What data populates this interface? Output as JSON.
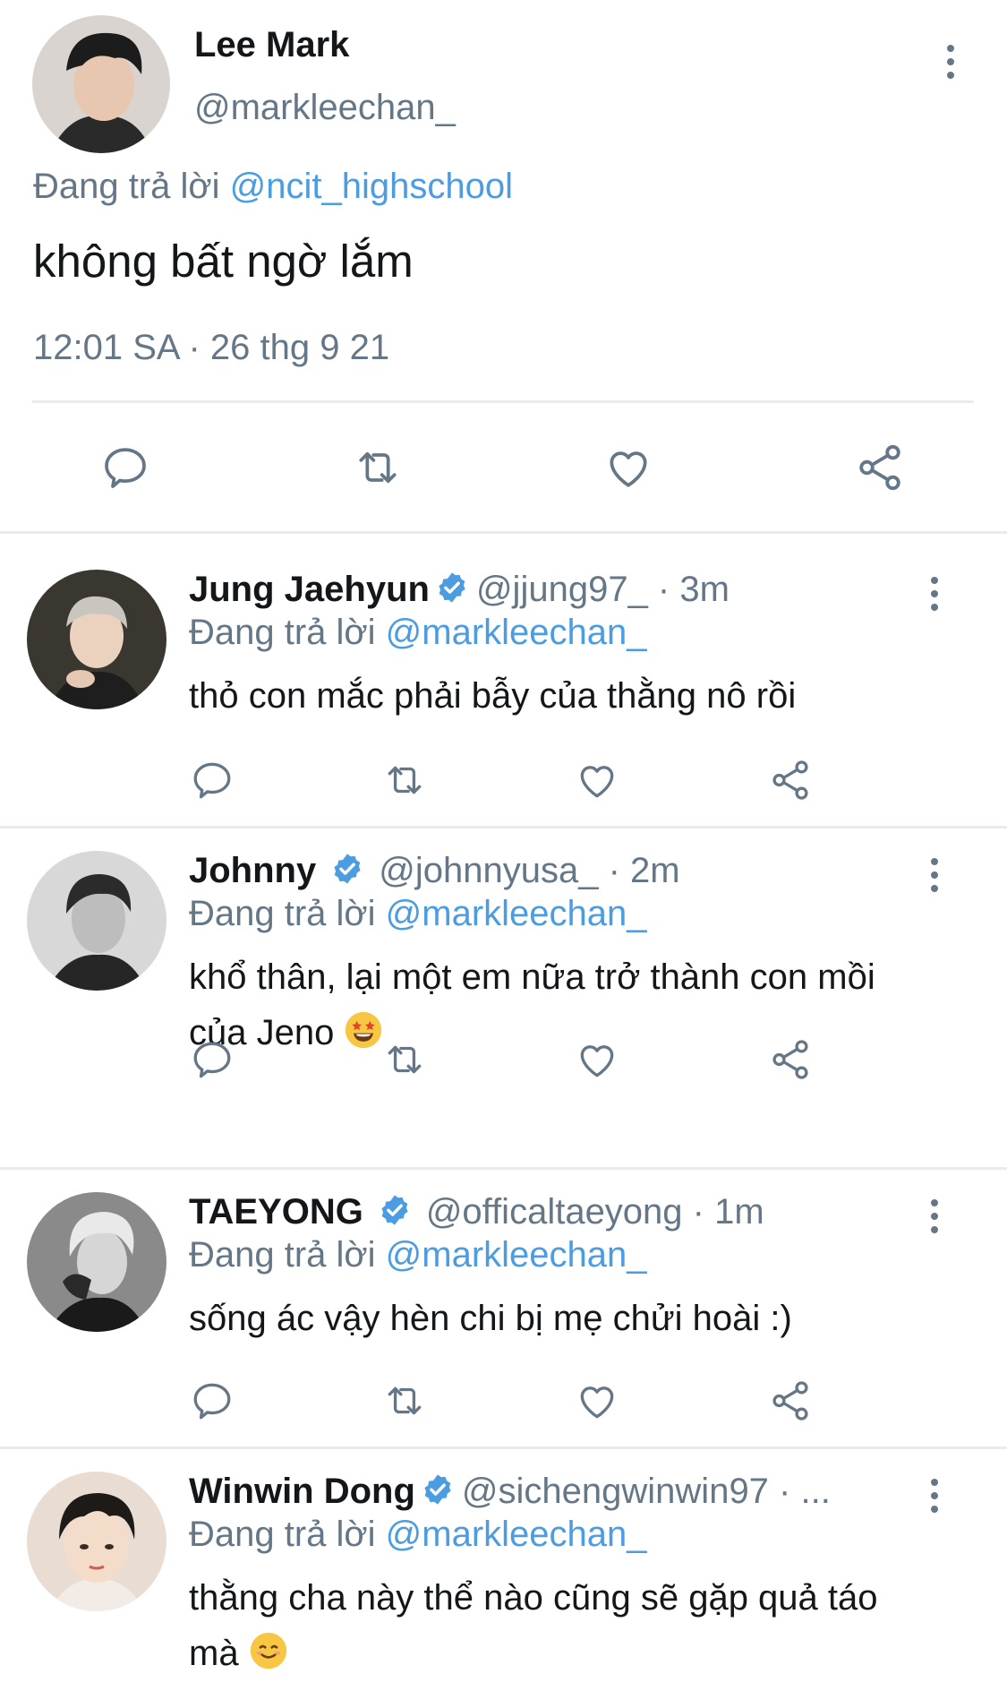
{
  "main_tweet": {
    "author_name": "Lee Mark",
    "author_handle": "@markleechan_",
    "replying_prefix": "Đang trả lời",
    "replying_to": "@ncit_highschool",
    "text": "không bất ngờ lắm",
    "timestamp": "12:01 SA · 26 thg 9 21"
  },
  "replies": [
    {
      "name": "Jung Jaehyun",
      "verified": true,
      "handle": "@jjung97_",
      "time": " · 3m",
      "replying_prefix": "Đang trả lời",
      "replying_to": "@markleechan_",
      "text": "thỏ con mắc phải bẫy của thằng nô rồi"
    },
    {
      "name": "Johnny",
      "verified": true,
      "handle": "@johnnyusa_",
      "time": " · 2m",
      "replying_prefix": "Đang trả lời",
      "replying_to": "@markleechan_",
      "text": "khổ thân, lại một em nữa  trở thành con mồi của Jeno",
      "emoji": "star-struck-emoji"
    },
    {
      "name": "TAEYONG",
      "verified": true,
      "handle": "@officaltaeyong",
      "time": " · 1m",
      "replying_prefix": "Đang trả lời",
      "replying_to": "@markleechan_",
      "text": "sống ác vậy hèn chi bị mẹ chửi hoài :)"
    },
    {
      "name": "Winwin Dong",
      "verified": true,
      "handle": "@sichengwinwin97",
      "time": " · ...",
      "replying_prefix": "Đang trả lời",
      "replying_to": "@markleechan_",
      "text": "thằng cha này thể nào cũng sẽ gặp quả táo mà",
      "emoji": "smiling-emoji"
    }
  ],
  "icons": [
    "reply-icon",
    "retweet-icon",
    "like-icon",
    "share-icon",
    "more-options-icon",
    "verified-badge-icon"
  ],
  "colors": {
    "link": "#4b9ce0",
    "muted": "#657786",
    "text": "#14171a",
    "divider": "#e6ecf0",
    "verified": "#4b9ce0"
  }
}
